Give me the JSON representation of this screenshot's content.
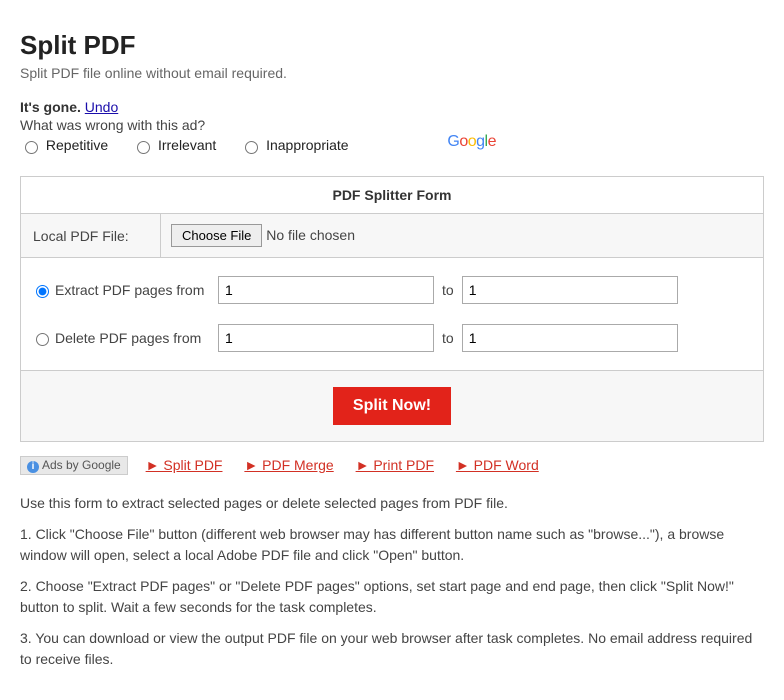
{
  "page": {
    "title": "Split PDF",
    "subtitle": "Split PDF file online without email required."
  },
  "ad_feedback": {
    "gone_label": "It's gone.",
    "undo_label": "Undo",
    "wrong_question": "What was wrong with this ad?",
    "option_repetitive": "Repetitive",
    "option_irrelevant": "Irrelevant",
    "option_inappropriate": "Inappropriate",
    "logo": {
      "g1": "G",
      "o1": "o",
      "o2": "o",
      "g2": "g",
      "l": "l",
      "e": "e"
    }
  },
  "form": {
    "header": "PDF Splitter Form",
    "file_label": "Local PDF File:",
    "choose_button": "Choose File",
    "no_file": "No file chosen",
    "extract_label": "Extract PDF pages from",
    "delete_label": "Delete PDF pages from",
    "to_label": "to",
    "extract_from": "1",
    "extract_to": "1",
    "delete_from": "1",
    "delete_to": "1",
    "submit_label": "Split Now!"
  },
  "ads": {
    "badge": "Ads by Google",
    "link1": "► Split PDF",
    "link2": "► PDF Merge",
    "link3": "► Print PDF",
    "link4": "► PDF Word"
  },
  "instructions": {
    "intro": "Use this form to extract selected pages or delete selected pages from PDF file.",
    "step1": "1. Click \"Choose File\" button (different web browser may has different button name such as \"browse...\"), a browse window will open, select a local Adobe PDF file and click \"Open\" button.",
    "step2": "2. Choose \"Extract PDF pages\" or \"Delete PDF pages\" options, set start page and end page, then click \"Split Now!\" button to split. Wait a few seconds for the task completes.",
    "step3": "3. You can download or view the output PDF file on your web browser after task completes. No email address required to receive files."
  }
}
